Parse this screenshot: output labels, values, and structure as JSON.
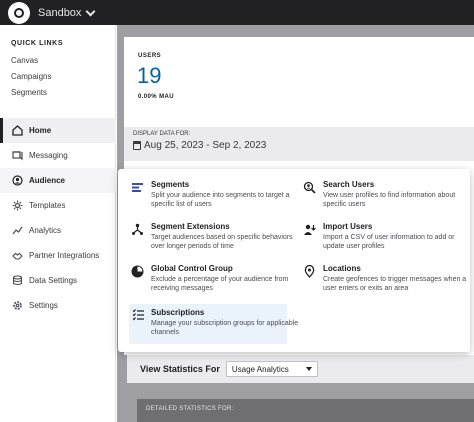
{
  "topbar": {
    "workspace": "Sandbox"
  },
  "sidebar": {
    "quick_links_title": "QUICK LINKS",
    "quick_links": [
      "Canvas",
      "Campaigns",
      "Segments"
    ],
    "items": [
      {
        "label": "Home",
        "icon": "home-icon"
      },
      {
        "label": "Messaging",
        "icon": "messaging-icon"
      },
      {
        "label": "Audience",
        "icon": "audience-icon"
      },
      {
        "label": "Templates",
        "icon": "templates-icon"
      },
      {
        "label": "Analytics",
        "icon": "analytics-icon"
      },
      {
        "label": "Partner Integrations",
        "icon": "partner-integrations-icon"
      },
      {
        "label": "Data Settings",
        "icon": "data-settings-icon"
      },
      {
        "label": "Settings",
        "icon": "settings-icon"
      }
    ]
  },
  "main": {
    "users_label": "USERS",
    "users_count": "19",
    "mau": "0.00% MAU",
    "date_label": "DISPLAY DATA FOR:",
    "date_range": "Aug 25, 2023 - Sep 2, 2023",
    "view_stats_label": "View Statistics For",
    "view_stats_value": "Usage Analytics",
    "detailed_stats": "DETAILED STATISTICS FOR:"
  },
  "audience_menu": [
    {
      "title": "Segments",
      "desc": "Split your audience into segments to target a specific list of users",
      "icon": "segments-icon"
    },
    {
      "title": "Search Users",
      "desc": "View user profiles to find information about specific users",
      "icon": "search-users-icon"
    },
    {
      "title": "Segment Extensions",
      "desc": "Target audiences based on specific behaviors over longer periods of time",
      "icon": "segment-extensions-icon"
    },
    {
      "title": "Import Users",
      "desc": "Import a CSV of user information to add or update user profiles",
      "icon": "import-users-icon"
    },
    {
      "title": "Global Control Group",
      "desc": "Exclude a percentage of your audience from receiving messages",
      "icon": "global-control-group-icon"
    },
    {
      "title": "Locations",
      "desc": "Create geofences to trigger messages when a user enters or exits an area",
      "icon": "location-pin-icon"
    },
    {
      "title": "Subscriptions",
      "desc": "Manage your subscription groups for applicable channels",
      "icon": "subscriptions-icon"
    }
  ],
  "colors": {
    "topbar": "#212123",
    "accent": "#0a5f9c",
    "highlight": "#eaf3fb"
  }
}
